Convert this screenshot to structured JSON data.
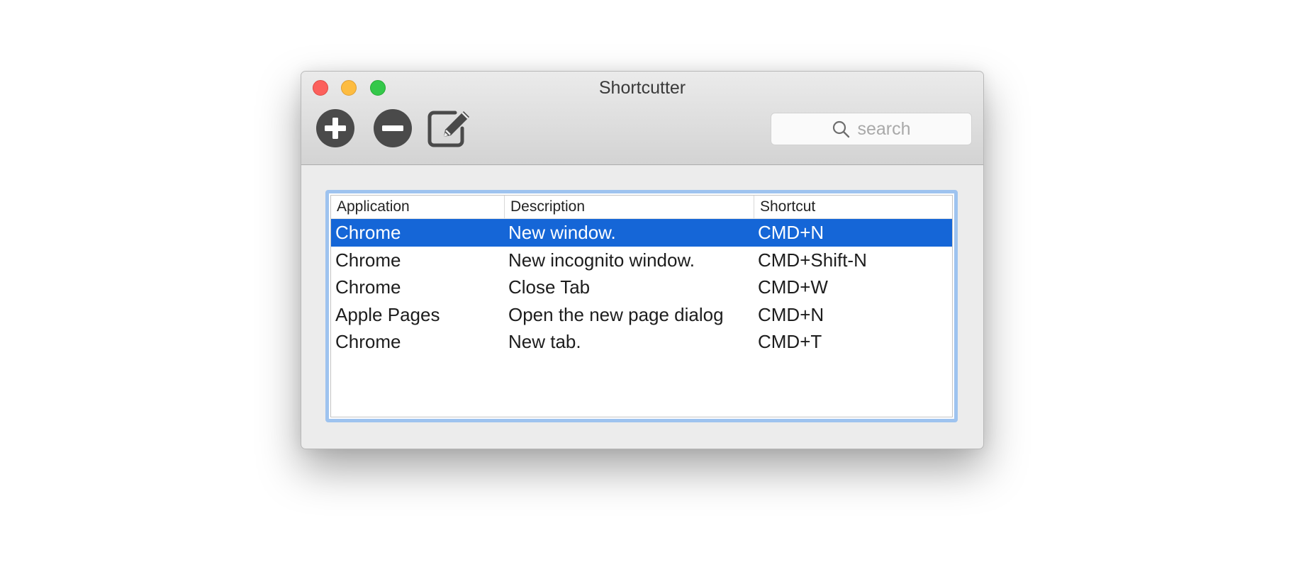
{
  "window": {
    "title": "Shortcutter",
    "controls": [
      "close",
      "minimize",
      "zoom"
    ]
  },
  "toolbar": {
    "buttons": [
      {
        "icon": "plus-circle-icon",
        "action": "add"
      },
      {
        "icon": "minus-circle-icon",
        "action": "remove"
      },
      {
        "icon": "edit-icon",
        "action": "edit"
      }
    ],
    "search": {
      "placeholder": "search",
      "icon": "search-icon"
    }
  },
  "table": {
    "columns": [
      "Application",
      "Description",
      "Shortcut"
    ],
    "rows": [
      {
        "application": "Chrome",
        "description": "New window.",
        "shortcut": "CMD+N",
        "selected": true
      },
      {
        "application": "Chrome",
        "description": "New incognito window.",
        "shortcut": "CMD+Shift-N",
        "selected": false
      },
      {
        "application": "Chrome",
        "description": "Close Tab",
        "shortcut": "CMD+W",
        "selected": false
      },
      {
        "application": "Apple Pages",
        "description": "Open the new page dialog",
        "shortcut": "CMD+N",
        "selected": false
      },
      {
        "application": "Chrome",
        "description": "New tab.",
        "shortcut": "CMD+T",
        "selected": false
      }
    ]
  },
  "colors": {
    "selection": "#1566d7",
    "focus_ring": "#9ec3ef",
    "close": "#fc605c",
    "minimize": "#fdbc40",
    "zoom": "#34c84a",
    "toolbar_icon": "#4a4a4a"
  }
}
